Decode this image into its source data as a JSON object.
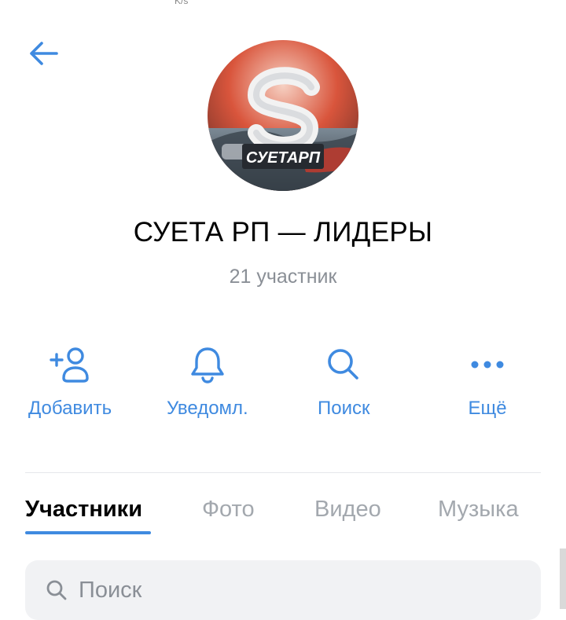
{
  "status_bar": {
    "speed_unit": "K/s"
  },
  "header": {
    "back_icon": "arrow-left-icon"
  },
  "profile": {
    "avatar_logo_text": "СУЕТАРП",
    "title": "СУЕТА РП — ЛИДЕРЫ",
    "subtitle": "21 участник"
  },
  "actions": [
    {
      "label": "Добавить",
      "icon": "add-user-icon"
    },
    {
      "label": "Уведомл.",
      "icon": "bell-icon"
    },
    {
      "label": "Поиск",
      "icon": "search-icon"
    },
    {
      "label": "Ещё",
      "icon": "more-dots-icon"
    }
  ],
  "tabs": [
    {
      "label": "Участники",
      "active": true
    },
    {
      "label": "Фото",
      "active": false
    },
    {
      "label": "Видео",
      "active": false
    },
    {
      "label": "Музыка",
      "active": false
    }
  ],
  "search": {
    "placeholder": "Поиск",
    "icon": "search-icon"
  },
  "colors": {
    "accent": "#3f8ae0",
    "secondary_text": "#8a8f96",
    "inactive_tab": "#a3a8ae",
    "search_bg": "#f1f2f4"
  }
}
